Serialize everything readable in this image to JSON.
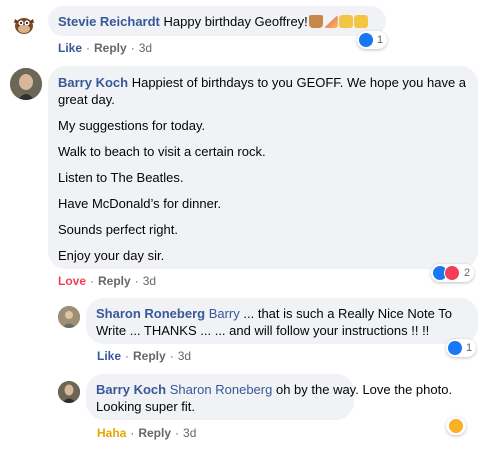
{
  "comments": [
    {
      "author": "Stevie Reichardt",
      "text": "Happy birthday Geoffrey!",
      "emoji": [
        "birthday-cake-emoji",
        "party-popper-emoji",
        "beer-mugs-emoji",
        "beer-mugs-emoji"
      ],
      "action": "Like",
      "time": "3d",
      "reaction_count": "1"
    },
    {
      "author": "Barry Koch",
      "paragraphs": [
        "Happiest of birthdays to you GEOFF. We hope you have a",
        "great day.",
        "My suggestions for today.",
        "Walk to beach to visit a certain rock.",
        "Listen to The Beatles.",
        "Have McDonald’s for dinner.",
        "Sounds perfect right.",
        "Enjoy your day sir."
      ],
      "action": "Love",
      "reply": "Reply",
      "time": "3d",
      "reaction_count": "2"
    },
    {
      "author": "Sharon Roneberg",
      "mention": "Barry",
      "line1": "... that is such a Really Nice Note To",
      "line2": "Write ... THANKS ... ... and will follow your instructions !! !!",
      "action": "Like",
      "reply": "Reply",
      "time": "3d",
      "reaction_count": "1"
    },
    {
      "author": "Barry Koch",
      "mention": "Sharon Roneberg",
      "line1": "oh by the way. Love the photo.",
      "line2": "Looking super fit.",
      "action": "Haha",
      "reply": "Reply",
      "time": "3d"
    }
  ],
  "reply_label": "Reply",
  "colors": {
    "bubble": "#f0f2f5",
    "link": "#385898",
    "love": "#f33e58",
    "haha": "#e8a600",
    "like_icon": "#1877f2"
  }
}
